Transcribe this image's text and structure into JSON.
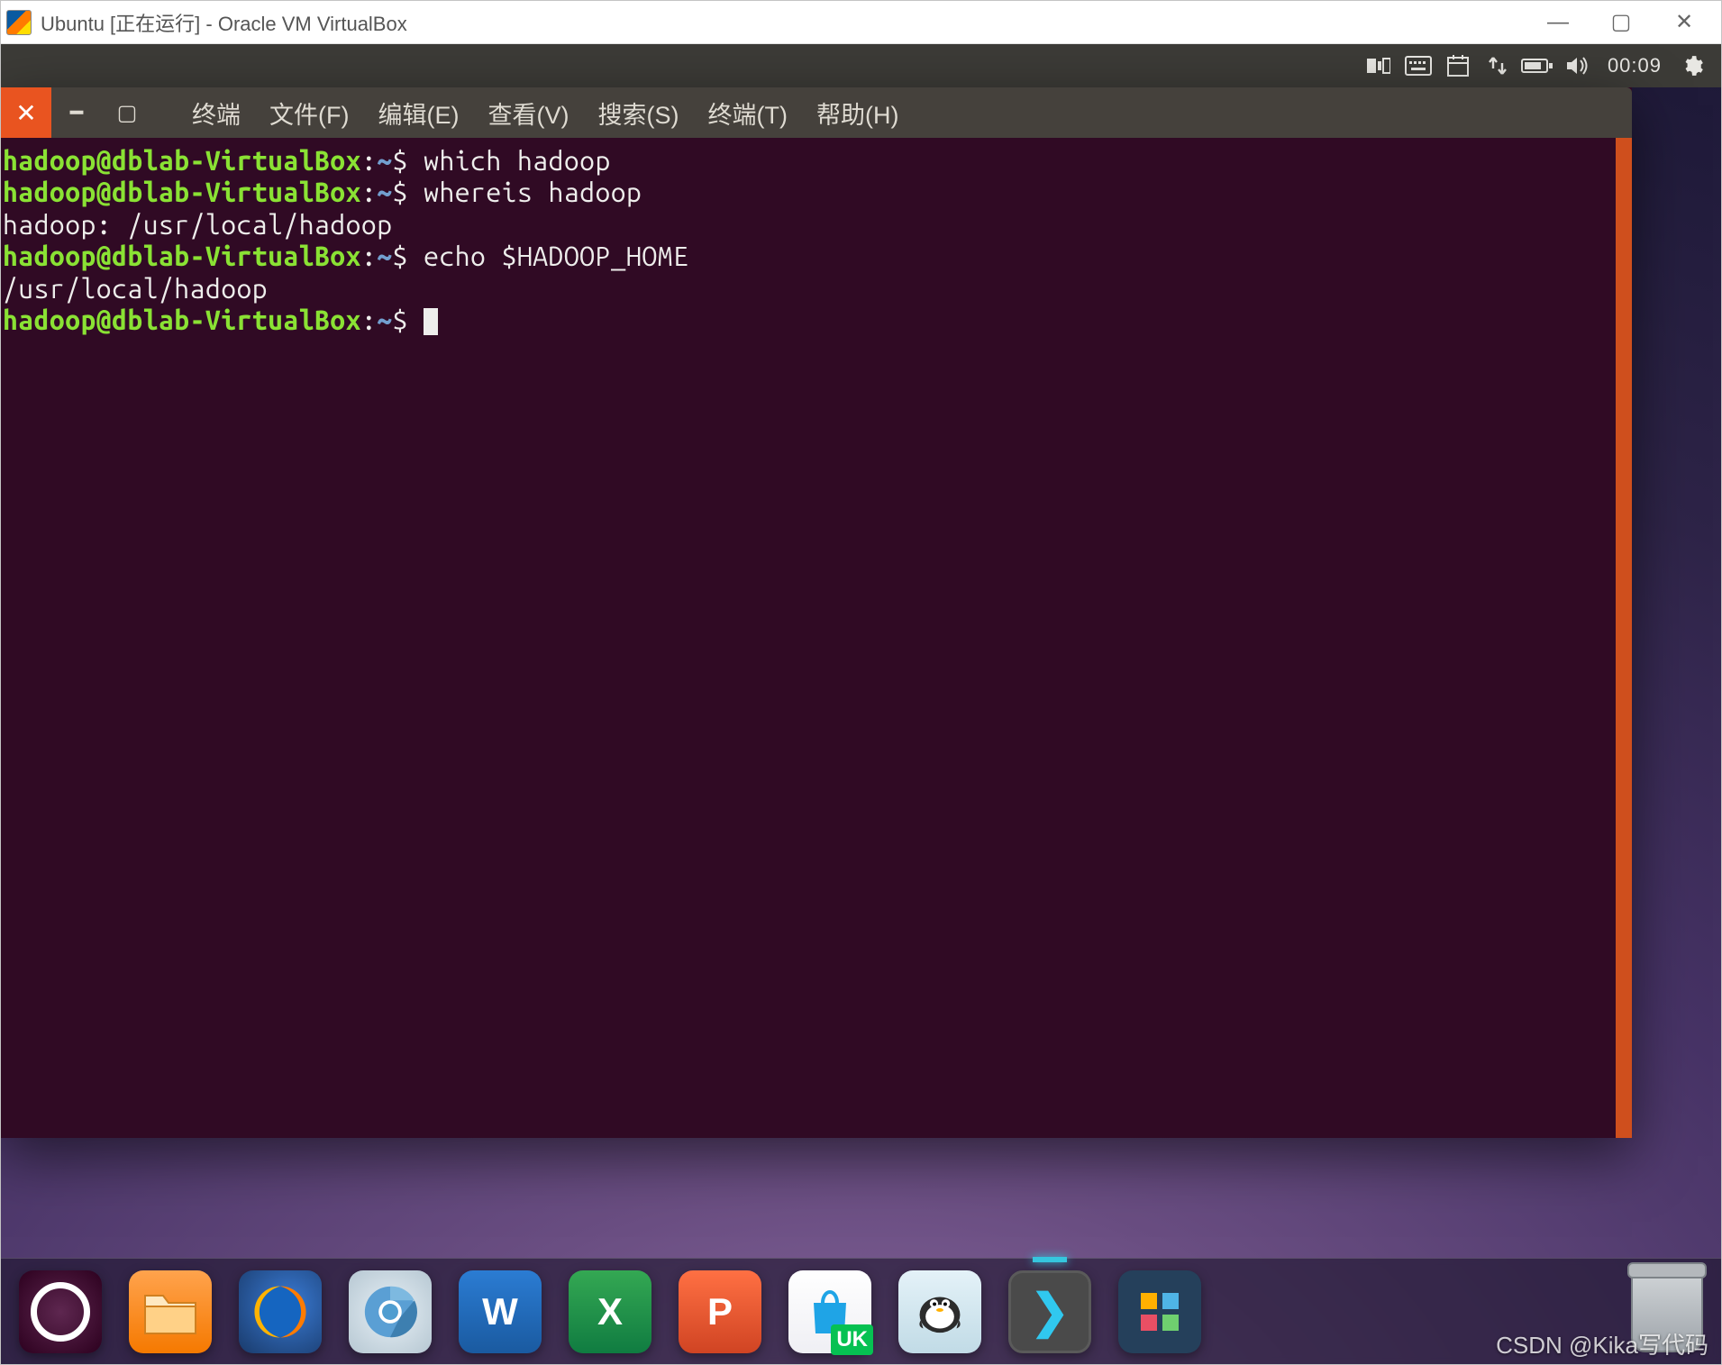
{
  "vbox": {
    "title": "Ubuntu [正在运行] - Oracle VM VirtualBox",
    "min_glyph": "—",
    "max_glyph": "▢",
    "close_glyph": "✕"
  },
  "panel": {
    "time": "00:09"
  },
  "terminal": {
    "app_label": "终端",
    "menu": [
      "文件(F)",
      "编辑(E)",
      "查看(V)",
      "搜索(S)",
      "终端(T)",
      "帮助(H)"
    ],
    "close_glyph": "✕",
    "min_glyph": "━",
    "max_glyph": "▢",
    "prompt_user": "hadoop@dblab-VirtualBox",
    "prompt_path": "~",
    "prompt_symbol": "$",
    "lines": [
      {
        "type": "prompt",
        "cmd": "which hadoop"
      },
      {
        "type": "prompt",
        "cmd": "whereis hadoop"
      },
      {
        "type": "output",
        "text": "hadoop: /usr/local/hadoop"
      },
      {
        "type": "prompt",
        "cmd": "echo $HADOOP_HOME"
      },
      {
        "type": "output",
        "text": "/usr/local/hadoop"
      },
      {
        "type": "prompt",
        "cmd": "",
        "cursor": true
      }
    ]
  },
  "dock": {
    "items": [
      {
        "id": "ubuntu",
        "label": "",
        "title": "Show Applications"
      },
      {
        "id": "files",
        "label": "",
        "title": "Files"
      },
      {
        "id": "firefox",
        "label": "",
        "title": "Firefox"
      },
      {
        "id": "chromium",
        "label": "",
        "title": "Chromium"
      },
      {
        "id": "word",
        "label": "W",
        "title": "WPS Writer"
      },
      {
        "id": "excel",
        "label": "X",
        "title": "WPS Spreadsheets"
      },
      {
        "id": "ppt",
        "label": "P",
        "title": "WPS Presentation"
      },
      {
        "id": "uk",
        "label": "",
        "title": "Ubuntu Kylin Software",
        "badge": "UK"
      },
      {
        "id": "qq",
        "label": "",
        "title": "Assistant"
      },
      {
        "id": "term",
        "label": "❯",
        "title": "Terminal",
        "active": true
      },
      {
        "id": "apps",
        "label": "",
        "title": "Apps"
      }
    ],
    "trash_title": "Trash"
  },
  "watermark": "CSDN @Kika写代码"
}
